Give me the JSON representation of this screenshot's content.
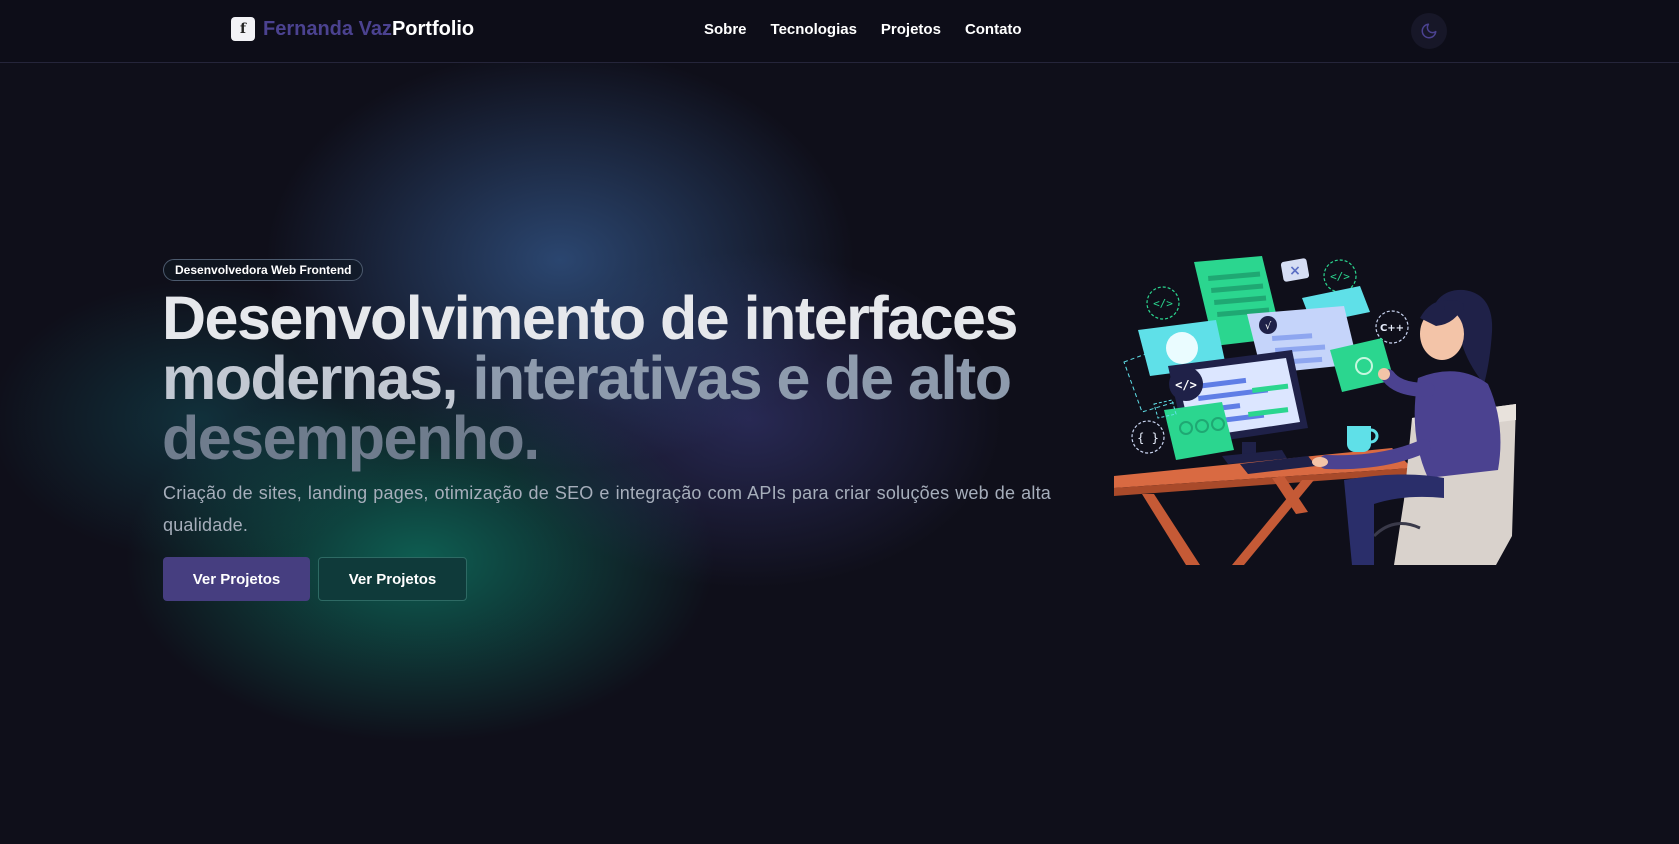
{
  "brand": {
    "icon_glyph": "f",
    "name": "Fernanda Vaz",
    "suffix": "Portfolio"
  },
  "nav": {
    "items": [
      {
        "label": "Sobre"
      },
      {
        "label": "Tecnologias"
      },
      {
        "label": "Projetos"
      },
      {
        "label": "Contato"
      }
    ]
  },
  "theme_toggle": {
    "icon": "moon-icon"
  },
  "hero": {
    "badge": "Desenvolvedora Web Frontend",
    "title": {
      "line1": "Desenvolvimento de interfaces",
      "line2_part1": "modernas,",
      "line2_part2": " interativas e de alto",
      "line3": "desempenho."
    },
    "subtitle": "Criação de sites, landing pages, otimização de SEO e integração com APIs para criar soluções web de alta qualidade.",
    "primary_button": "Ver Projetos",
    "secondary_button": "Ver Projetos"
  },
  "illustration": {
    "code_tag": "</>",
    "cpp_tag": "C++",
    "braces_tag": "{ }",
    "check": "√",
    "close": "×"
  },
  "colors": {
    "background": "#0f0f1a",
    "brand_name": "#4b4290",
    "primary_button": "#463e80",
    "secondary_button": "#0f3a3a",
    "accent_green": "#2bd68f",
    "accent_cyan": "#5fe0e8",
    "desk": "#c85a3a"
  }
}
